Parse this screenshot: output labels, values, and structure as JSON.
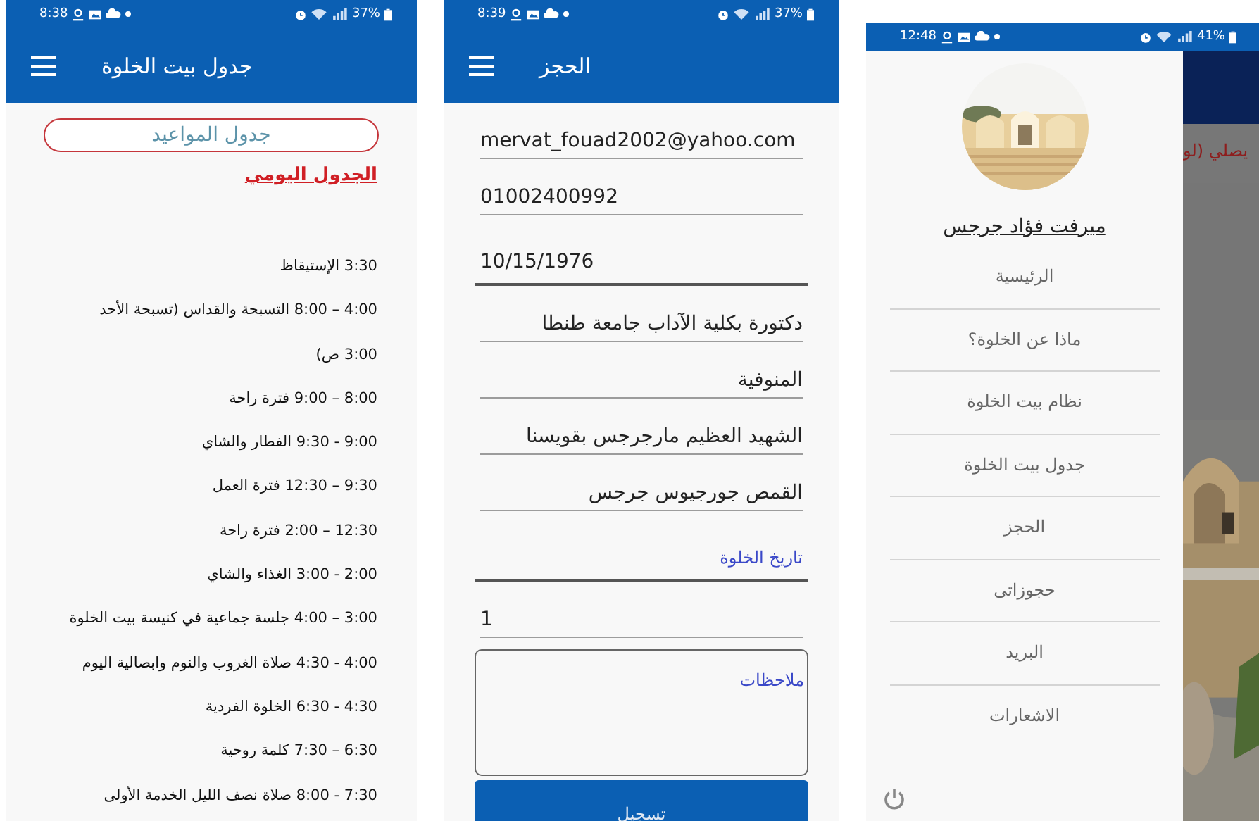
{
  "screens": [
    {
      "kind": "drawer",
      "status_bar": {
        "time": "12:48",
        "battery": "41%"
      },
      "profile_name": "ميرفت فؤاد جرجس",
      "menu": [
        "الرئيسية",
        "ماذا عن الخلوة؟",
        "نظام بيت الخلوة",
        "جدول بيت الخلوة",
        "الحجز",
        "حجوزاتى",
        "البريد",
        "الاشعارات"
      ],
      "background_text": "يصلي (لو"
    },
    {
      "kind": "booking",
      "status_bar": {
        "time": "8:39",
        "battery": "37%"
      },
      "app_bar": {
        "title": "الحجز"
      },
      "fields": [
        {
          "kind": "text",
          "value": "mervat_fouad2002@yahoo.com"
        },
        {
          "kind": "text",
          "value": "01002400992"
        },
        {
          "kind": "date",
          "value": "10/15/1976"
        },
        {
          "kind": "text",
          "value": "دكتورة بكلية الآداب جامعة طنطا"
        },
        {
          "kind": "text",
          "value": "المنوفية"
        },
        {
          "kind": "text",
          "value": "الشهيد العظيم مارجرجس بقويسنا"
        },
        {
          "kind": "text",
          "value": "القمص جورجيوس جرجس"
        },
        {
          "kind": "date",
          "placeholder": "تاريخ الخلوة"
        },
        {
          "kind": "text",
          "value": "1"
        },
        {
          "kind": "textarea",
          "placeholder": "ملاحظات"
        }
      ],
      "submit_button": "تسجيل"
    },
    {
      "kind": "schedule",
      "status_bar": {
        "time": "8:38",
        "battery": "37%"
      },
      "app_bar": {
        "title": "جدول بيت الخلوة"
      },
      "header_button": "جدول المواعيد",
      "section_title": "الجدول اليومي",
      "entries": [
        "3:30 الإستيقاظ",
        "4:00 – 8:00 التسبحة والقداس (تسبحة الأحد 3:00 ص)",
        "8:00 – 9:00 فترة راحة",
        "9:00 - 9:30 الفطار والشاي",
        "9:30 – 12:30 فترة العمل",
        "12:30 – 2:00 فترة راحة",
        "2:00 - 3:00 الغذاء والشاي",
        "3:00 – 4:00 جلسة جماعية في كنيسة بيت الخلوة",
        "4:00 - 4:30 صلاة الغروب والنوم وابصالية اليوم",
        "4:30 - 6:30 الخلوة الفردية",
        "6:30 – 7:30 كلمة روحية",
        "7:30 - 8:00 صلاة نصف الليل الخدمة الأولى"
      ]
    }
  ]
}
